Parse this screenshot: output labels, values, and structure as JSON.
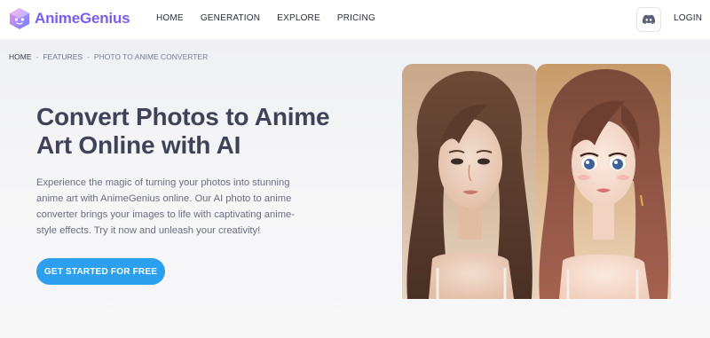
{
  "brand": {
    "name": "AnimeGenius",
    "accent": "#7b5cf0"
  },
  "nav": {
    "items": [
      {
        "label": "HOME"
      },
      {
        "label": "GENERATION"
      },
      {
        "label": "EXPLORE"
      },
      {
        "label": "PRICING"
      }
    ],
    "discord_icon": "discord-icon",
    "login_label": "LOGIN"
  },
  "breadcrumb": {
    "home": "HOME",
    "features": "FEATURES",
    "current": "PHOTO TO ANIME CONVERTER",
    "separator": "-"
  },
  "hero": {
    "title": "Convert Photos to Anime Art Online with AI",
    "description": "Experience the magic of turning your photos into stunning anime art with AnimeGenius online. Our AI photo to anime converter brings your images to life with captivating anime-style effects. Try it now and unleash your creativity!",
    "cta_label": "GET STARTED FOR FREE",
    "cta_color": "#2ca0ee"
  },
  "images": {
    "before": "real-photo-portrait",
    "after": "anime-art-portrait"
  }
}
